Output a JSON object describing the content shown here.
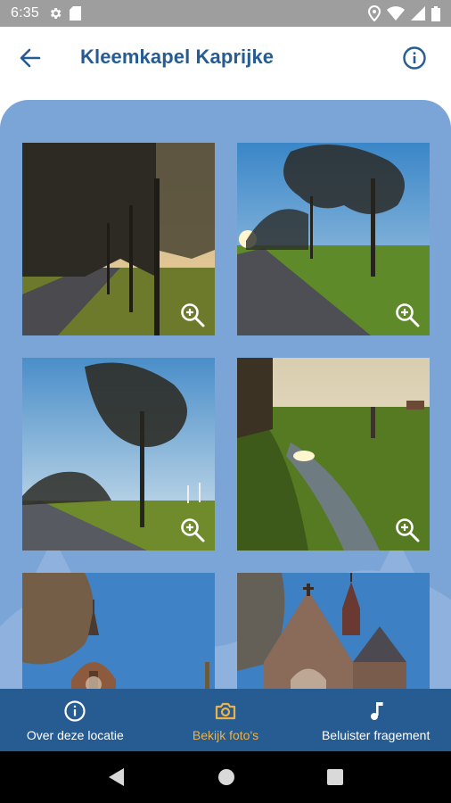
{
  "status_bar": {
    "time": "6:35",
    "left_icons": [
      "settings-icon",
      "sd-card-icon"
    ],
    "right_icons": [
      "location-icon",
      "wifi-icon",
      "signal-icon",
      "battery-icon"
    ]
  },
  "app_bar": {
    "title": "Kleemkapel Kaprijke",
    "back_icon": "arrow-left-icon",
    "info_icon": "info-icon",
    "title_color": "#265c91"
  },
  "gallery": {
    "background_color": "#7ba4d7",
    "photos": [
      {
        "name": "photo-tree-lane-1",
        "zoom_icon": "zoom-in-icon"
      },
      {
        "name": "photo-tree-lane-2",
        "zoom_icon": "zoom-in-icon"
      },
      {
        "name": "photo-tree-lane-3",
        "zoom_icon": "zoom-in-icon"
      },
      {
        "name": "photo-stream-field",
        "zoom_icon": "zoom-in-icon"
      },
      {
        "name": "photo-chapel-tower"
      },
      {
        "name": "photo-chapel-front"
      }
    ]
  },
  "bottom_nav": {
    "background_color": "#265c91",
    "active_color": "#e9b24a",
    "items": [
      {
        "label": "Over deze locatie",
        "icon": "info-icon",
        "active": false
      },
      {
        "label": "Bekijk foto's",
        "icon": "camera-icon",
        "active": true
      },
      {
        "label": "Beluister fragement",
        "icon": "music-note-icon",
        "active": false
      }
    ]
  },
  "system_nav": {
    "icons": [
      "back-triangle-icon",
      "home-circle-icon",
      "recents-square-icon"
    ]
  }
}
